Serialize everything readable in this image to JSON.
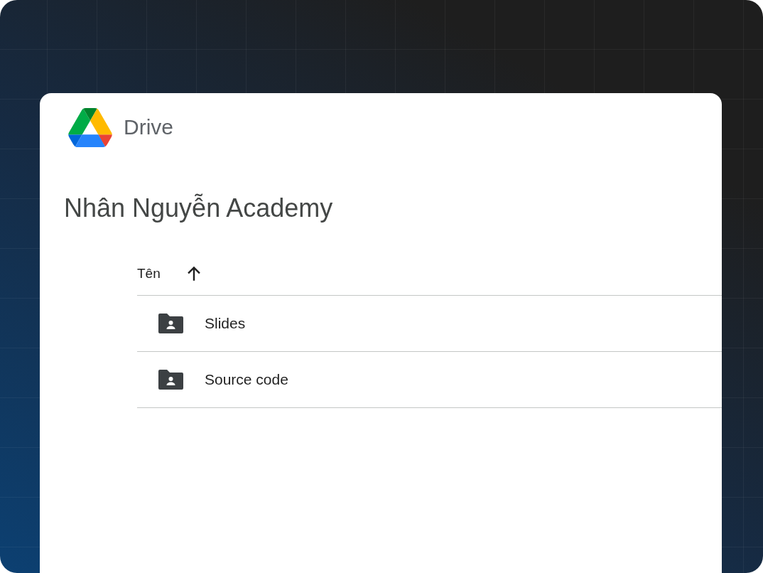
{
  "app": {
    "name": "Drive"
  },
  "folder_title": "Nhân Nguyễn Academy",
  "table": {
    "columns": [
      {
        "label": "Tên",
        "sorted": true,
        "ascending": true
      }
    ],
    "rows": [
      {
        "name": "Slides"
      },
      {
        "name": "Source code"
      }
    ]
  }
}
